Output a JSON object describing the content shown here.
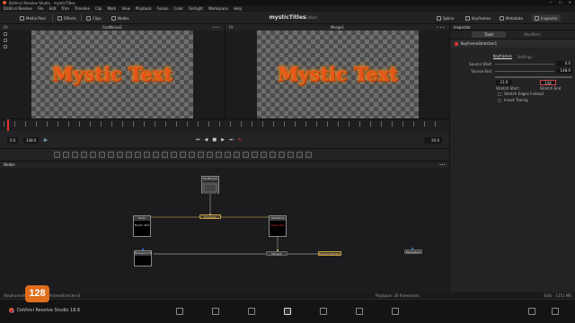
{
  "window": {
    "title": "DaVinci Resolve Studio - mysticTitles",
    "controls": [
      "—",
      "☐",
      "✕"
    ]
  },
  "menu": [
    "DaVinci Resolve",
    "File",
    "Edit",
    "Trim",
    "Timeline",
    "Clip",
    "Mark",
    "View",
    "Playback",
    "Fusion",
    "Color",
    "Fairlight",
    "Workspace",
    "Help"
  ],
  "toolbar": {
    "media_pool": "Media Pool",
    "effects": "Effects",
    "clips": "Clips",
    "nodes": "Nodes",
    "project_title": "mysticTitles",
    "project_status": "Edited",
    "spline": "Spline",
    "keyframes": "Keyframes",
    "metadata": "Metadata",
    "inspector": "Inspector"
  },
  "viewers": [
    {
      "name": "FastNoise2",
      "fit": "Fit",
      "overlay_text": "Mystic Text"
    },
    {
      "name": "Merge1",
      "fit": "Fit",
      "overlay_text": "Mystic Text"
    }
  ],
  "inspector": {
    "title": "Inspector",
    "tabs": [
      "Tools",
      "Modifiers"
    ],
    "node_name": "KeyframeStretcher1",
    "subtabs": [
      "Keyframes",
      "Settings"
    ],
    "params": [
      {
        "label": "Source Start",
        "value": "0.0"
      },
      {
        "label": "Source End",
        "value": "148.0"
      }
    ],
    "stretch_start": "21.0",
    "stretch_end": "134",
    "stretch_start_label": "Stretch Start",
    "stretch_end_label": "Stretch End",
    "checkboxes": [
      "Stretch Edges Instead",
      "Invert Timing"
    ]
  },
  "transport": {
    "start": "0.0",
    "end": "148.0",
    "current": "20.0"
  },
  "nodes_panel": {
    "title": "Nodes",
    "nodes": [
      {
        "id": "fastnoise2",
        "label": "FastNoise2"
      },
      {
        "id": "text1",
        "label": "Text1",
        "content": "Mystic Text"
      },
      {
        "id": "polygon1",
        "label": "Polygon1"
      },
      {
        "id": "text_with",
        "label": "TextWith1",
        "content": "Apple Pen"
      },
      {
        "id": "background1",
        "label": "Background1"
      },
      {
        "id": "merge1",
        "label": "Merge1"
      },
      {
        "id": "keyframestretcher",
        "label": "KeyframeStretc..."
      },
      {
        "id": "mediaout1",
        "label": "MediaOut1"
      }
    ]
  },
  "status": {
    "left": "[KeyframeStretcher1 (KeyframeStretcher)]",
    "mid": "Playback: 30 frames/sec",
    "right": "63% - 1351 MB"
  },
  "pagebar": {
    "brand": "DaVinci Resolve Studio 18.6"
  },
  "badge": "128"
}
